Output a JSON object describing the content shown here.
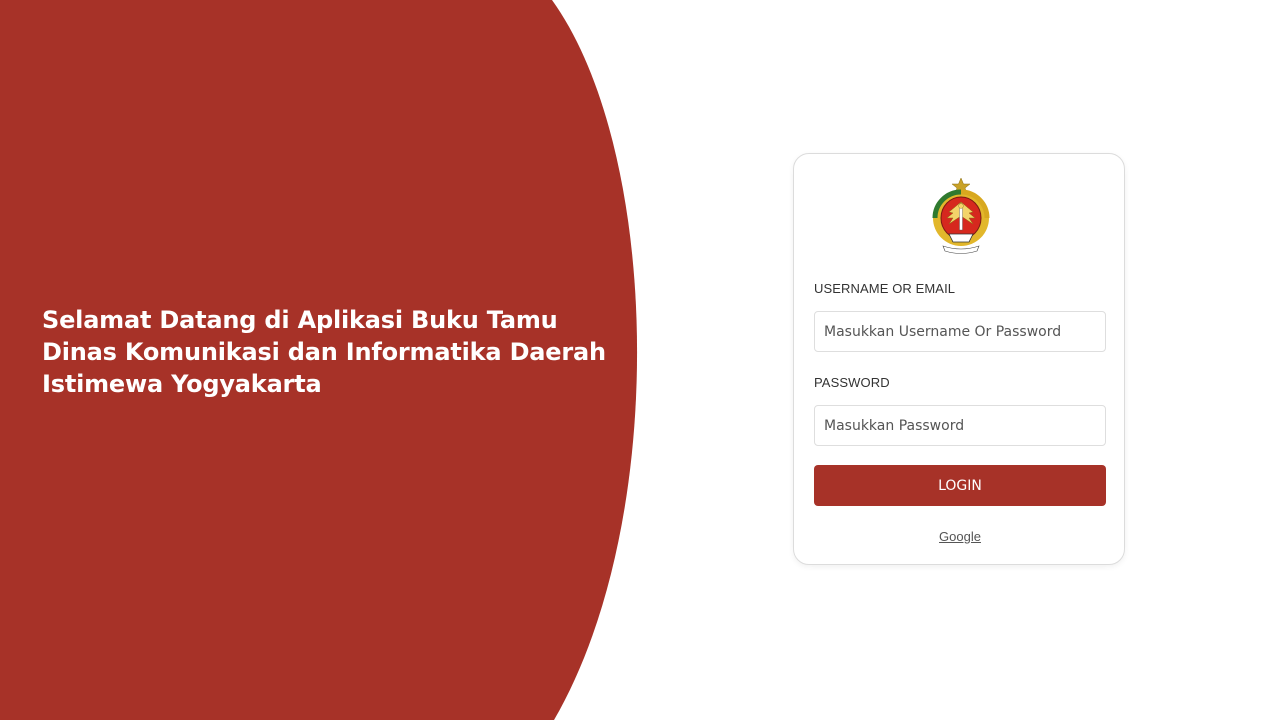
{
  "hero": {
    "welcome_text": "Selamat Datang di Aplikasi Buku Tamu Dinas Komunikasi dan Informatika Daerah Istimewa Yogyakarta",
    "background_color": "#a73228"
  },
  "login_card": {
    "logo_icon": "diy-coat-of-arms-icon",
    "username": {
      "label": "USERNAME OR EMAIL",
      "placeholder": "Masukkan Username Or Password",
      "value": ""
    },
    "password": {
      "label": "PASSWORD",
      "placeholder": "Masukkan Password",
      "value": ""
    },
    "login_button_label": "LOGIN",
    "google_link_label": "Google",
    "accent_color": "#a73228"
  }
}
